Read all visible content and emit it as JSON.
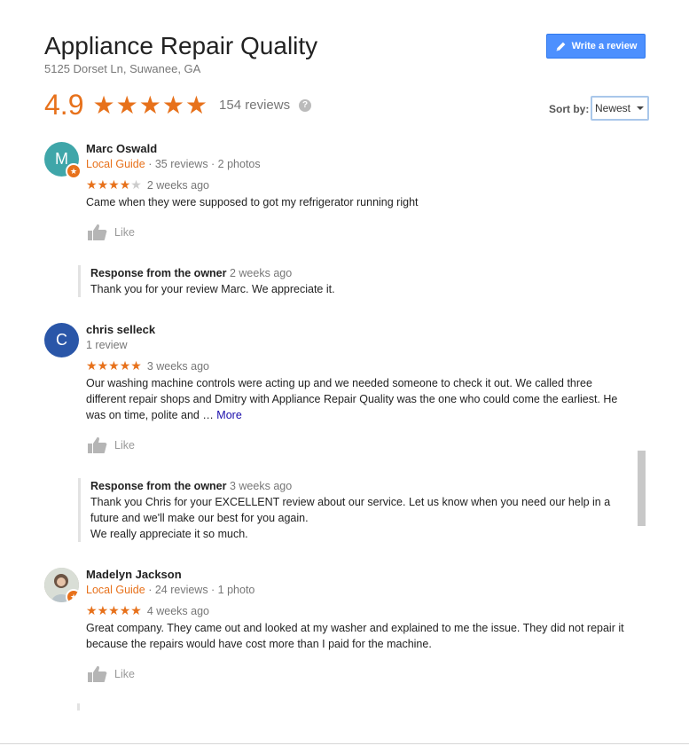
{
  "header": {
    "title": "Appliance Repair Quality",
    "address": "5125 Dorset Ln, Suwanee, GA",
    "write_review_label": "Write a review",
    "rating": "4.9",
    "rating_stars_value": 4.9,
    "review_count": "154 reviews",
    "help_icon": "?",
    "sort_label": "Sort by:",
    "sort_value": "Newest"
  },
  "colors": {
    "accent": "#e7711b",
    "button_blue": "#4d90fe",
    "link": "#1a0dab",
    "avatar_marc": "#3fa6a9",
    "avatar_chris": "#2a56a8"
  },
  "reviews": [
    {
      "author": "Marc Oswald",
      "avatar_letter": "M",
      "local_guide": "Local Guide",
      "stats": " · 35 reviews · 2 photos",
      "stars": 4,
      "time": "2 weeks ago",
      "text": "Came when they were supposed to got my refrigerator running right",
      "like_label": "Like",
      "response_label": "Response from the owner",
      "response_time": "2 weeks ago",
      "response_text": "Thank you for your review Marc. We appreciate it."
    },
    {
      "author": "chris selleck",
      "avatar_letter": "C",
      "stats": "1 review",
      "stars": 5,
      "time": "3 weeks ago",
      "text": "Our washing machine controls were acting up and we needed someone to check it out. We called three different repair shops and Dmitry with Appliance Repair Quality was the one who could come the earliest.  He was on time, polite and … ",
      "more_label": "More",
      "like_label": "Like",
      "response_label": "Response from the owner",
      "response_time": "3 weeks ago",
      "response_text_1": "Thank you Chris for your EXCELLENT review about our service. Let us know when you need our help in a future and we'll make our best for you again.",
      "response_text_2": "We really appreciate it so much."
    },
    {
      "author": "Madelyn Jackson",
      "local_guide": "Local Guide",
      "stats": " · 24 reviews · 1 photo",
      "stars": 5,
      "time": "4 weeks ago",
      "text": "Great company. They came out and looked at my washer and explained to me the issue. They did not repair it because the repairs would have cost more than I paid for the machine.",
      "like_label": "Like"
    }
  ],
  "icons": {
    "star_full": "★",
    "badge": "★",
    "pencil": "pencil-icon",
    "thumbs_up": "thumbs-up-icon",
    "caret": "caret-down-icon"
  }
}
